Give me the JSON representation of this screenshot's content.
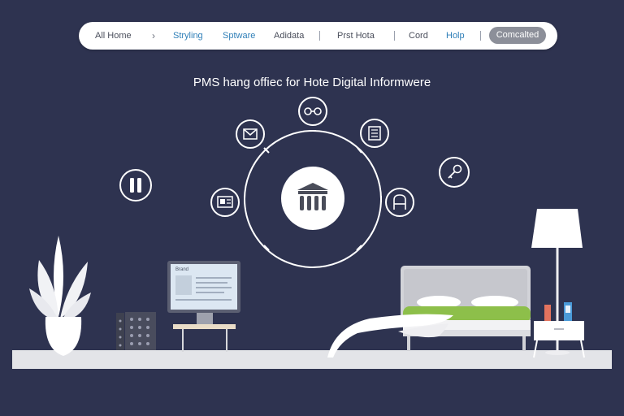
{
  "nav": {
    "items": [
      {
        "label": "All Home"
      },
      {
        "label": "Stryling"
      },
      {
        "label": "Sptware"
      },
      {
        "label": "Adidata"
      },
      {
        "label": "Prst Hota"
      },
      {
        "label": "Cord"
      },
      {
        "label": "Holp"
      }
    ],
    "contact_label": "Comcalted"
  },
  "hero": {
    "title": "PMS hang offiec for Hote Digital Informwere"
  },
  "monitor": {
    "heading": "Brand"
  },
  "colors": {
    "background": "#2e3350",
    "accent_green": "#8dbf4a",
    "link_blue": "#2f7fb8"
  },
  "icons": {
    "center": "hotel-building-icon",
    "top": "link-icon",
    "top_left": "mail-icon",
    "top_right": "document-list-icon",
    "left": "image-card-icon",
    "right": "chair-icon",
    "far_left": "pause-icon",
    "far_right": "key-icon"
  }
}
